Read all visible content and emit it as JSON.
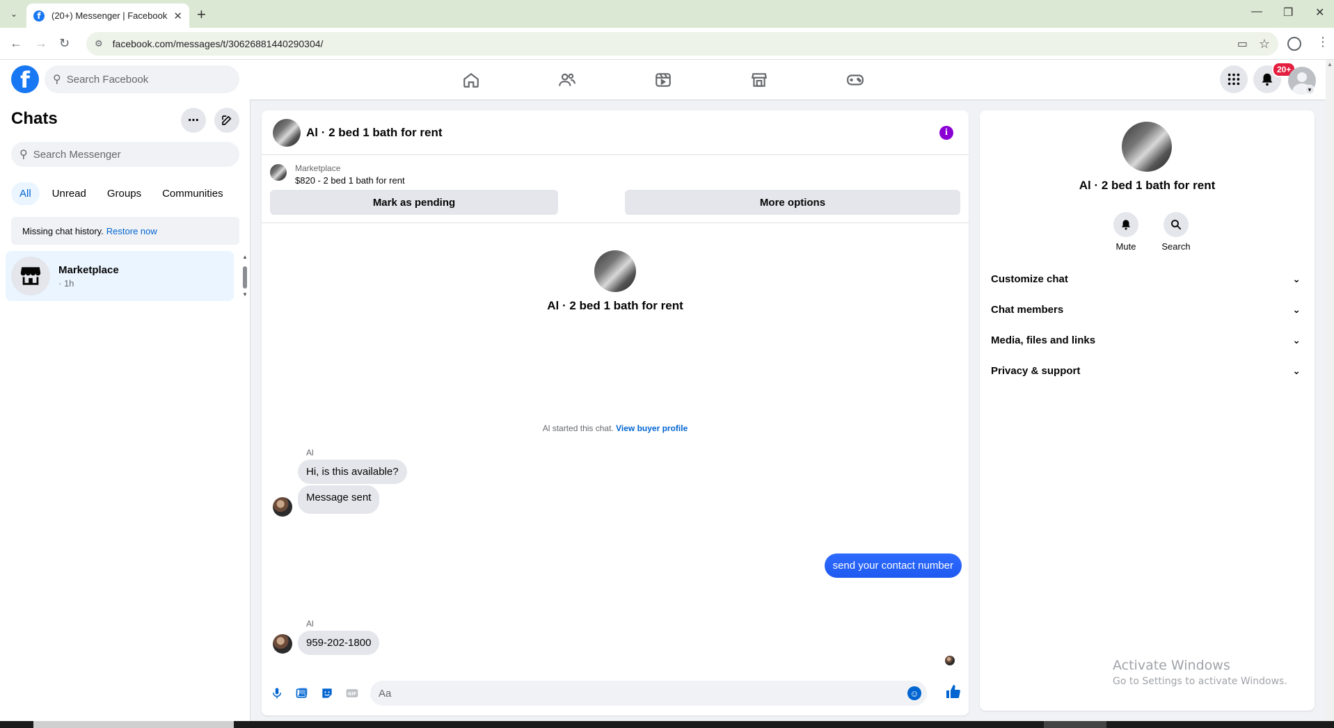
{
  "browser": {
    "tab_title": "(20+) Messenger | Facebook",
    "url": "facebook.com/messages/t/30626881440290304/",
    "new_tab": "+",
    "close_tab": "✕"
  },
  "fb_header": {
    "search_placeholder": "Search Facebook",
    "notification_badge": "20+",
    "brand_color": "#1877f2"
  },
  "chats_panel": {
    "title": "Chats",
    "search_placeholder": "Search Messenger",
    "filters": [
      "All",
      "Unread",
      "Groups",
      "Communities"
    ],
    "active_filter": "All",
    "missing_history_text": "Missing chat history.",
    "restore_link": "Restore now",
    "items": [
      {
        "name": "Marketplace",
        "meta": "· 1h",
        "icon": "storefront-icon"
      }
    ]
  },
  "conversation": {
    "title": "Al · 2 bed 1 bath for rent",
    "marketplace_label": "Marketplace",
    "listing": "$820 - 2 bed 1 bath for rent",
    "mark_pending": "Mark as pending",
    "more_options": "More options",
    "intro_title": "Al · 2 bed 1 bath for rent",
    "started_text": "Al started this chat.",
    "buyer_profile_link": "View buyer profile",
    "messages": [
      {
        "sender": "Al",
        "text": "Hi, is this available?",
        "direction": "in"
      },
      {
        "sender": "",
        "text": "Message sent",
        "direction": "in"
      },
      {
        "sender": "",
        "text": "send your contact number",
        "direction": "out"
      },
      {
        "sender": "Al",
        "text": "959-202-1800",
        "direction": "in"
      }
    ],
    "composer_placeholder": "Aa",
    "outgoing_color": "#2f6bff"
  },
  "info_panel": {
    "name": "Al · 2 bed 1 bath for rent",
    "actions": [
      {
        "label": "Mute",
        "icon": "bell-icon"
      },
      {
        "label": "Search",
        "icon": "search-icon"
      }
    ],
    "sections": [
      "Customize chat",
      "Chat members",
      "Media, files and links",
      "Privacy & support"
    ]
  },
  "watermark": {
    "line1": "Activate Windows",
    "line2": "Go to Settings to activate Windows."
  }
}
